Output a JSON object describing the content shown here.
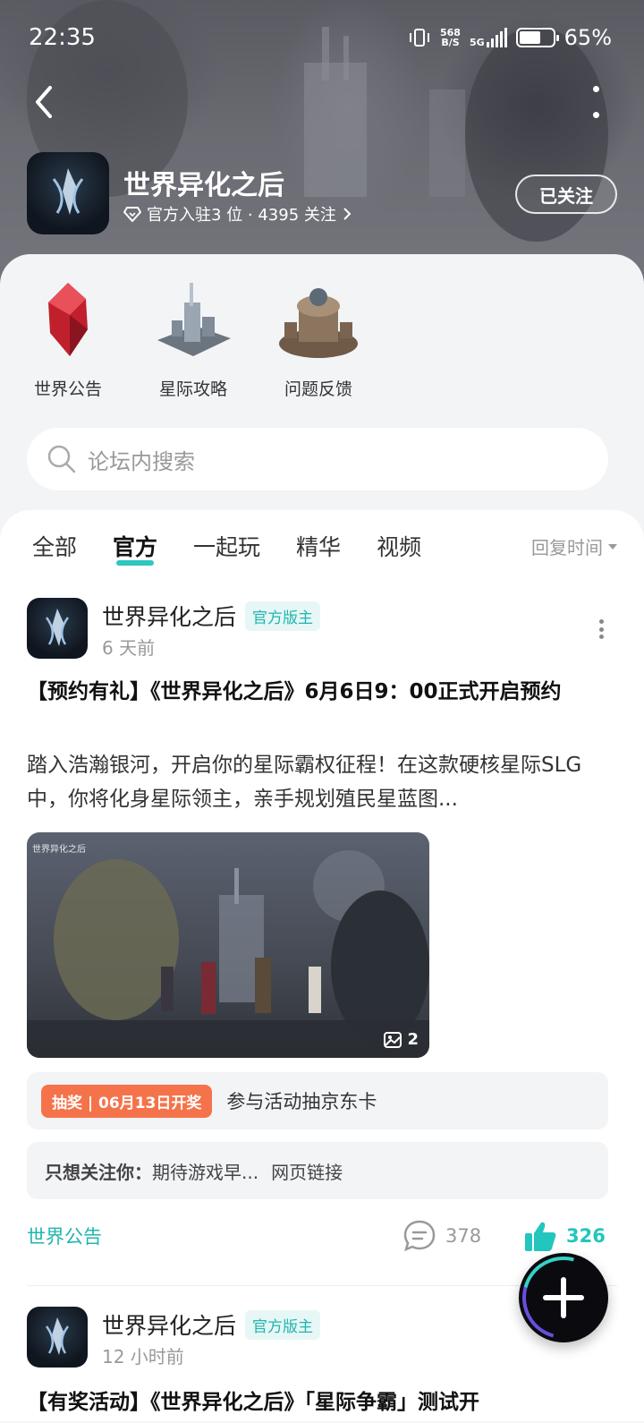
{
  "status": {
    "time": "22:35",
    "net_speed_top": "568",
    "net_speed_bottom": "B/S",
    "network": "5G",
    "battery": "65%"
  },
  "header": {
    "title": "世界异化之后",
    "meta": "官方入驻3 位 · 4395 关注",
    "follow_label": "已关注"
  },
  "shortcuts": [
    {
      "label": "世界公告"
    },
    {
      "label": "星际攻略"
    },
    {
      "label": "问题反馈"
    }
  ],
  "search": {
    "placeholder": "论坛内搜索"
  },
  "tabs": [
    "全部",
    "官方",
    "一起玩",
    "精华",
    "视频"
  ],
  "active_tab": "官方",
  "sort_label": "回复时间",
  "posts": [
    {
      "author": "世界异化之后",
      "badge": "官方版主",
      "time": "6 天前",
      "title": "【预约有礼】《世界异化之后》6月6日9：00正式开启预约",
      "body": "踏入浩瀚银河，开启你的星际霸权征程！在这款硬核星际SLG中，你将化身星际领主，亲手规划殖民星蓝图...",
      "image_watermark": "世界异化之后",
      "image_count": "2",
      "lottery_tag": "抽奖 | 06月13日开奖",
      "lottery_text": "参与活动抽京东卡",
      "poll_label": "只想关注你：",
      "poll_text": "期待游戏早...",
      "poll_link": "网页链接",
      "forum": "世界公告",
      "comments": "378",
      "likes": "326"
    },
    {
      "author": "世界异化之后",
      "badge": "官方版主",
      "time": "12 小时前",
      "title": "【有奖活动】《世界异化之后》「星际争霸」测试开"
    }
  ],
  "colors": {
    "accent": "#22b5ae",
    "lottery": "#f5734a",
    "like": "#22c6bd"
  }
}
